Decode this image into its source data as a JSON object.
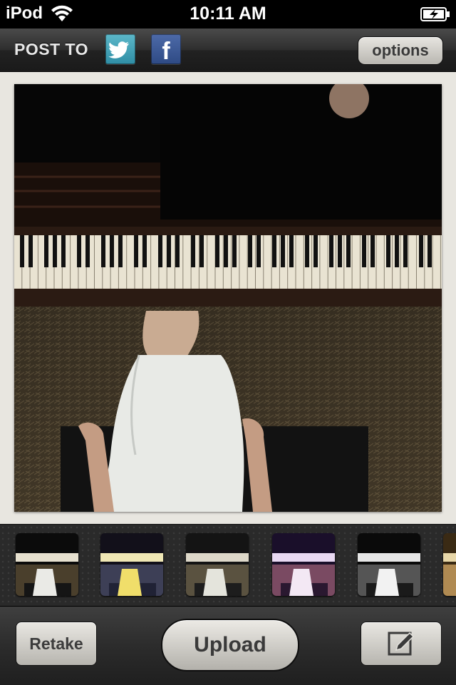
{
  "status_bar": {
    "carrier": "iPod",
    "time": "10:11 AM",
    "battery_state": "charging"
  },
  "toolbar": {
    "post_to_label": "POST TO",
    "share_targets": [
      {
        "name": "twitter",
        "icon": "twitter-bird-icon",
        "color": "#3fa3bb"
      },
      {
        "name": "facebook",
        "icon": "facebook-f-icon",
        "glyph": "f",
        "color": "#3b5998"
      }
    ],
    "options_label": "options"
  },
  "photo": {
    "description_icon": "photo-preview"
  },
  "filters": [
    {
      "name": "normal"
    },
    {
      "name": "warm-yellow"
    },
    {
      "name": "faded"
    },
    {
      "name": "purple-cross"
    },
    {
      "name": "black-white"
    },
    {
      "name": "sepia"
    }
  ],
  "bottom_bar": {
    "retake_label": "Retake",
    "upload_label": "Upload",
    "edit_icon": "compose-edit-icon"
  },
  "colors": {
    "toolbar": "#2e2e2e",
    "canvas": "#e8e6e0",
    "button": "#d4d2cc"
  }
}
